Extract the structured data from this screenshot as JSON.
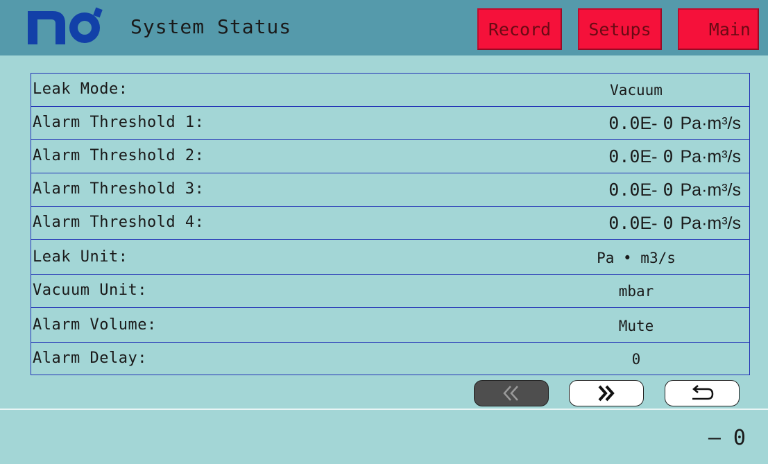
{
  "header": {
    "title": "System Status",
    "buttons": {
      "record": "Record",
      "setups": "Setups",
      "main": "Main"
    }
  },
  "rows": [
    {
      "label": "Leak Mode:",
      "value": "Vacuum"
    },
    {
      "label": "Alarm Threshold 1:",
      "number": "0.0",
      "exp_mark": "E-",
      "exp": "0",
      "unit": "Pa·m³/s"
    },
    {
      "label": "Alarm Threshold 2:",
      "number": "0.0",
      "exp_mark": "E-",
      "exp": "0",
      "unit": "Pa·m³/s"
    },
    {
      "label": "Alarm Threshold 3:",
      "number": "0.0",
      "exp_mark": "E-",
      "exp": "0",
      "unit": "Pa·m³/s"
    },
    {
      "label": "Alarm Threshold 4:",
      "number": "0.0",
      "exp_mark": "E-",
      "exp": "0",
      "unit": "Pa·m³/s"
    },
    {
      "label": "Leak Unit:",
      "value": "Pa • m3/s"
    },
    {
      "label": "Vacuum Unit:",
      "value": "mbar"
    },
    {
      "label": "Alarm Volume:",
      "value": "Mute"
    },
    {
      "label": "Alarm Delay:",
      "value": "0"
    }
  ],
  "nav": {
    "prev_icon": "double-chevron-left-icon",
    "next_icon": "double-chevron-right-icon",
    "back_icon": "return-arrow-icon"
  },
  "footer": {
    "value": "– 0"
  },
  "colors": {
    "background": "#a3d6d6",
    "header": "#559aab",
    "button_red": "#f5113a",
    "logo_blue": "#1240a8",
    "table_border": "#1f2fb5"
  }
}
